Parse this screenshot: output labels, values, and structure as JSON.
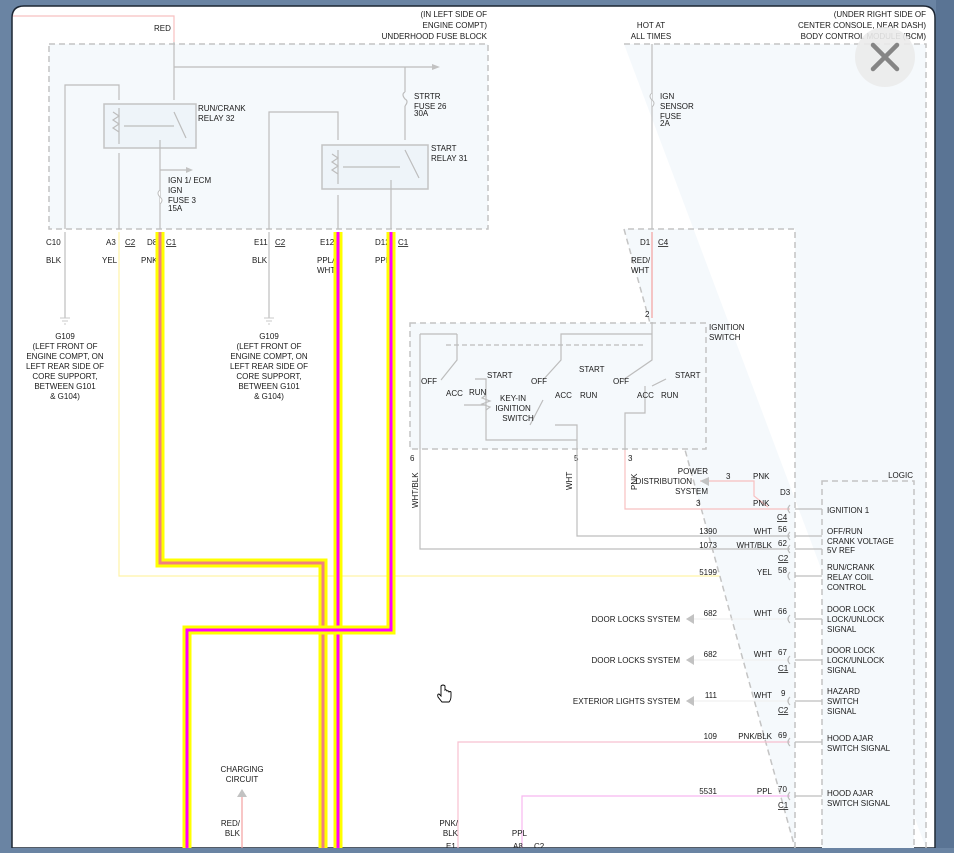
{
  "colors": {
    "highlight": "#ffff00",
    "pnk_core": "#f08080",
    "ppl_core": "#ff00ff",
    "wire": "#bdbdbd",
    "red_wire": "#f4a0a0"
  },
  "fuse_block": {
    "title": [
      "(IN LEFT SIDE OF",
      "ENGINE COMPT)",
      "UNDERHOOD FUSE BLOCK"
    ],
    "feed": "RED",
    "relay32": [
      "RUN/CRANK",
      "RELAY 32"
    ],
    "fuse26": [
      "STRTR",
      "FUSE 26",
      "30A"
    ],
    "relay31": [
      "START",
      "RELAY 31"
    ],
    "fuse3": [
      "IGN 1/ ECM",
      "IGN",
      "FUSE 3",
      "15A"
    ],
    "pins": [
      {
        "pin": "C10",
        "color": "BLK"
      },
      {
        "pin": "A3",
        "conn": "C2",
        "color": "YEL"
      },
      {
        "pin": "D8",
        "conn": "C1",
        "color": "PNK"
      },
      {
        "pin": "E11",
        "conn": "C2",
        "color": "BLK"
      },
      {
        "pin": "E12",
        "color1": "PPL/",
        "color2": "WHT"
      },
      {
        "pin": "D12",
        "conn": "C1",
        "color": "PPL"
      }
    ]
  },
  "ground": [
    "G109",
    "(LEFT FRONT OF",
    "ENGINE COMPT, ON",
    "LEFT REAR SIDE OF",
    "CORE SUPPORT,",
    "BETWEEN G101",
    "& G104)"
  ],
  "bcm": {
    "title": [
      "(UNDER RIGHT SIDE OF",
      "CENTER CONSOLE, NEAR DASH)",
      "BODY CONTROL MODULE (BCM)"
    ],
    "hot": [
      "HOT AT",
      "ALL TIMES"
    ],
    "fuse": [
      "IGN",
      "SENSOR",
      "FUSE",
      "2A"
    ],
    "pin": "D1",
    "conn": "C4",
    "color1": "RED/",
    "color2": "WHT",
    "logic": "LOGIC"
  },
  "ignition_switch": {
    "title": [
      "IGNITION",
      "SWITCH"
    ],
    "in_pin": "2",
    "keyin": [
      "KEY-IN",
      "IGNITION",
      "SWITCH"
    ],
    "positions": {
      "off": "OFF",
      "acc": "ACC",
      "run": "RUN",
      "start": "START"
    },
    "out_pins": [
      {
        "pin": "6",
        "color": "WHT/BLK"
      },
      {
        "pin": "5",
        "color": "WHT"
      },
      {
        "pin": "3",
        "color": "PNK"
      }
    ]
  },
  "power_dist": {
    "label": [
      "POWER",
      "DISTRIBUTION",
      "SYSTEM"
    ],
    "pin_a": "3",
    "color_a": "PNK",
    "pin_b": "3",
    "color_b": "PNK",
    "conn_pin": "D3",
    "conn": "C4"
  },
  "bcm_rows": [
    {
      "circuit": "",
      "color": "",
      "pin": "",
      "label": [
        "IGNITION 1"
      ]
    },
    {
      "circuit": "1390",
      "color": "WHT",
      "pin": "56",
      "label": [
        "OFF/RUN",
        "CRANK VOLTAGE",
        "5V REF"
      ]
    },
    {
      "circuit": "1073",
      "color": "WHT/BLK",
      "pin": "62",
      "conn": "C2"
    },
    {
      "circuit": "5199",
      "color": "YEL",
      "pin": "58",
      "label": [
        "RUN/CRANK",
        "RELAY COIL",
        "CONTROL"
      ]
    },
    {
      "circuit": "682",
      "color": "WHT",
      "pin": "66",
      "dest": "DOOR LOCKS SYSTEM",
      "label": [
        "DOOR LOCK",
        "LOCK/UNLOCK",
        "SIGNAL"
      ]
    },
    {
      "circuit": "682",
      "color": "WHT",
      "pin": "67",
      "conn": "C1",
      "dest": "DOOR LOCKS SYSTEM",
      "label": [
        "DOOR LOCK",
        "LOCK/UNLOCK",
        "SIGNAL"
      ]
    },
    {
      "circuit": "111",
      "color": "WHT",
      "pin": "9",
      "conn": "C2",
      "dest": "EXTERIOR LIGHTS SYSTEM",
      "label": [
        "HAZARD",
        "SWITCH",
        "SIGNAL"
      ]
    },
    {
      "circuit": "109",
      "color": "PNK/BLK",
      "pin": "69",
      "label": [
        "HOOD AJAR",
        "SWITCH SIGNAL"
      ]
    },
    {
      "circuit": "5531",
      "color": "PPL",
      "pin": "70",
      "conn": "C1",
      "label": [
        "HOOD AJAR",
        "SWITCH SIGNAL"
      ]
    }
  ],
  "bottom": {
    "charging": [
      "CHARGING",
      "CIRCUIT"
    ],
    "charging_color": [
      "RED/",
      "BLK"
    ],
    "pnkblk": [
      "PNK/",
      "BLK"
    ],
    "pnkblk_pin": "E1",
    "ppl": "PPL",
    "ppl_pin": "A8",
    "ppl_conn": "C2"
  },
  "close_icon": "close-x-icon"
}
